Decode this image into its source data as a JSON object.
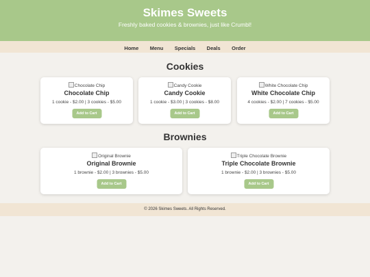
{
  "header": {
    "title": "Skimes Sweets",
    "tagline": "Freshly baked cookies & brownies, just like Crumbl!"
  },
  "nav": {
    "items": [
      "Home",
      "Menu",
      "Specials",
      "Deals",
      "Order"
    ]
  },
  "cookies": {
    "title": "Cookies",
    "items": [
      {
        "alt": "Chocolate Chip",
        "name": "Chocolate Chip",
        "price": "1 cookie - $2.00 | 3 cookies - $5.00",
        "button": "Add to Cart"
      },
      {
        "alt": "Candy Cookie",
        "name": "Candy Cookie",
        "price": "1 cookie - $3.00 | 3 cookies - $8.00",
        "button": "Add to Cart"
      },
      {
        "alt": "White Chocolate Chip",
        "name": "White Chocolate Chip",
        "price": "4 cookies - $2.00 | 7 cookies - $5.00",
        "button": "Add to Cart"
      }
    ]
  },
  "brownies": {
    "title": "Brownies",
    "items": [
      {
        "alt": "Original Brownie",
        "name": "Original Brownie",
        "price": "1 brownie - $2.00 | 3 brownies - $5.00",
        "button": "Add to Cart"
      },
      {
        "alt": "Triple Chocolate Brownie",
        "name": "Triple Chocolate Brownie",
        "price": "1 brownie - $2.00 | 3 brownies - $5.00",
        "button": "Add to Cart"
      }
    ]
  },
  "footer": {
    "text": "© 2026 Skimes Sweets. All Rights Reserved."
  },
  "colors": {
    "accent_green": "#a8c88a",
    "nav_beige": "#f1e5d4",
    "background": "#f3f1ed"
  }
}
